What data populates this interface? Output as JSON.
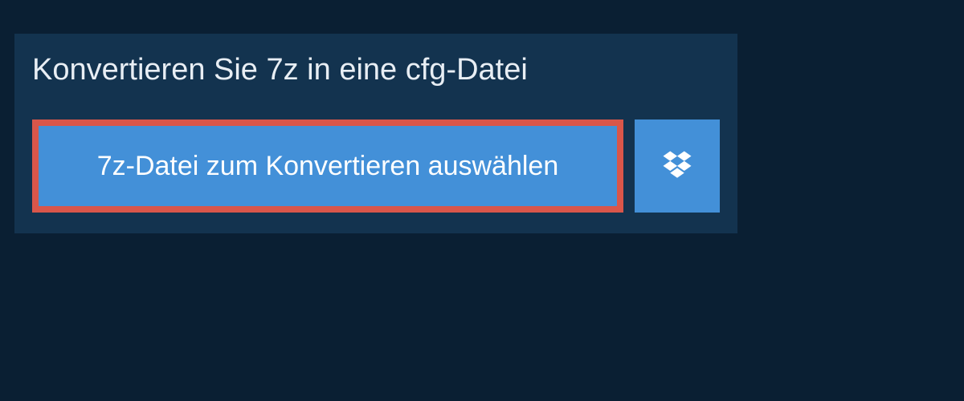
{
  "header": {
    "title": "Konvertieren Sie 7z in eine cfg-Datei"
  },
  "actions": {
    "select_file_label": "7z-Datei zum Konvertieren auswählen",
    "dropbox_aria": "Dropbox"
  },
  "colors": {
    "background": "#0a1f33",
    "panel": "#13334f",
    "button": "#4390d8",
    "highlight": "#d9564a"
  }
}
